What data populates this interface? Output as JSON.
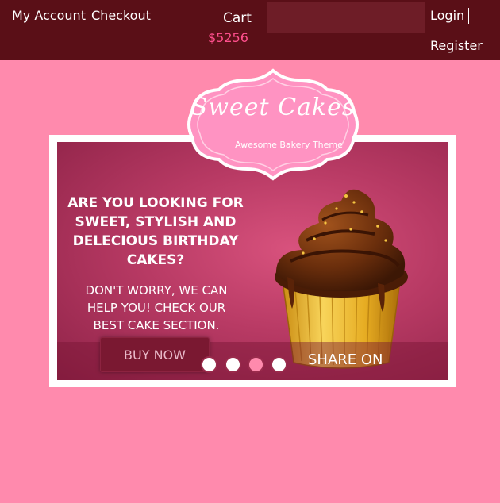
{
  "header": {
    "my_account": "My Account",
    "checkout": "Checkout",
    "cart_label": "Cart",
    "cart_total": "$5256",
    "login": "Login",
    "register": "Register"
  },
  "logo": {
    "title": "Sweet Cakes",
    "tagline": "Awesome Bakery Theme"
  },
  "slider": {
    "headline": "Are you looking for sweet, stylish and delecious birthday cakes?",
    "subline": "Don't worry, we can help you! Check our best cake section.",
    "buy_button": "Buy Now",
    "share_label": "Share On",
    "slide_count": 4,
    "active_slide": 3
  },
  "colors": {
    "page_bg": "#ff8aad",
    "header_bg": "#5a0f17",
    "cart_total": "#ff4f8d",
    "button_bg": "#7a1831"
  }
}
